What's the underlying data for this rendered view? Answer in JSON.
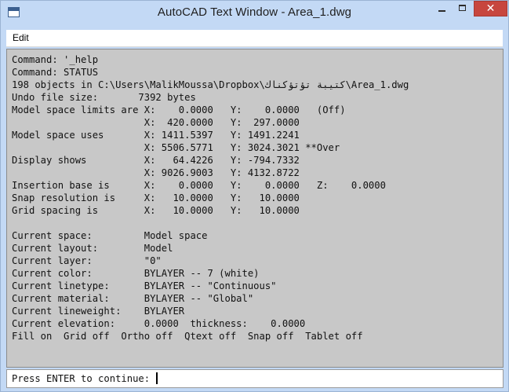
{
  "window": {
    "title": "AutoCAD Text Window - Area_1.dwg",
    "icon": "autocad-text-window-icon",
    "controls": {
      "minimize": "minimize",
      "maximize": "maximize",
      "close_glyph": "✕"
    }
  },
  "menu": {
    "items": [
      {
        "label": "Edit"
      }
    ]
  },
  "console": {
    "lines": [
      "Command: '_help",
      "Command: STATUS",
      "198 objects in C:\\Users\\MalikMoussa\\Dropbox\\كتيبة تؤتؤكناك\\Area_1.dwg",
      "Undo file size:       7392 bytes",
      "Model space limits are X:    0.0000   Y:    0.0000   (Off)",
      "                       X:  420.0000   Y:  297.0000",
      "Model space uses       X: 1411.5397   Y: 1491.2241",
      "                       X: 5506.5771   Y: 3024.3021 **Over",
      "Display shows          X:   64.4226   Y: -794.7332",
      "                       X: 9026.9003   Y: 4132.8722",
      "Insertion base is      X:    0.0000   Y:    0.0000   Z:    0.0000",
      "Snap resolution is     X:   10.0000   Y:   10.0000",
      "Grid spacing is        X:   10.0000   Y:   10.0000",
      "",
      "Current space:         Model space",
      "Current layout:        Model",
      "Current layer:         \"0\"",
      "Current color:         BYLAYER -- 7 (white)",
      "Current linetype:      BYLAYER -- \"Continuous\"",
      "Current material:      BYLAYER -- \"Global\"",
      "Current lineweight:    BYLAYER",
      "Current elevation:     0.0000  thickness:    0.0000",
      "Fill on  Grid off  Ortho off  Qtext off  Snap off  Tablet off"
    ]
  },
  "prompt": {
    "text": "Press ENTER to continue: "
  }
}
